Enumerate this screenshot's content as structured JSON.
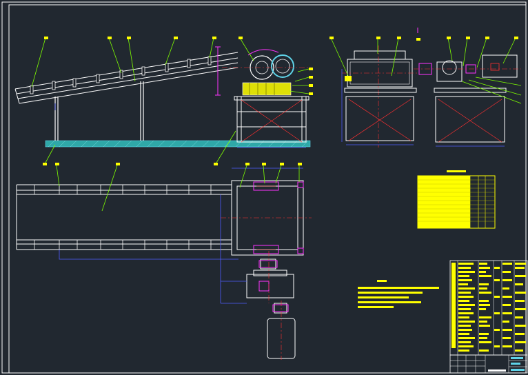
{
  "drawing": {
    "type": "belt conveyor assembly drawing",
    "background": "#212830",
    "colors": {
      "frame": "#ffffff",
      "leader": "#7fff00",
      "dimension": "#4f5cff",
      "centerline": "#ff3030",
      "table_fill": "#ffff00",
      "magenta": "#ff33ff",
      "cyan": "#5fd3e8",
      "ground": "#3ec5c5"
    },
    "icons": [
      "balloon-leader-icon",
      "ground-hatch-icon",
      "motor-icon",
      "reducer-icon"
    ],
    "tech_requirements": {
      "title_present": true,
      "line_count": 5
    },
    "parts_list": {
      "row_count": 12,
      "columns": 4
    },
    "bom_table": {
      "row_count": 24,
      "columns": 6
    }
  }
}
